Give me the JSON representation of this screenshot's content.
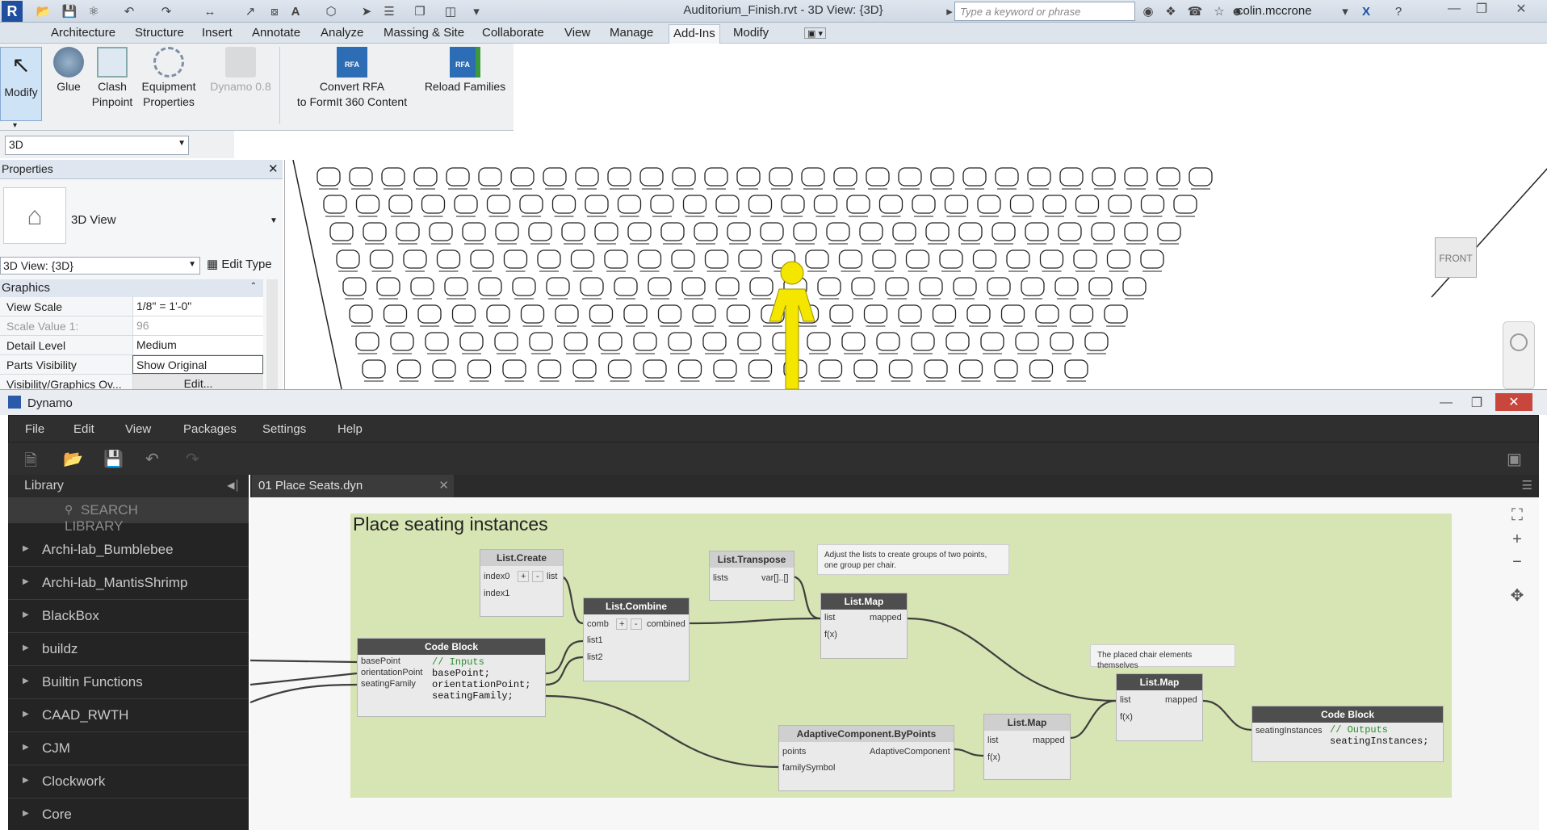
{
  "revit": {
    "title": "Auditorium_Finish.rvt - 3D View: {3D}",
    "search_placeholder": "Type a keyword or phrase",
    "user": "colin.mccrone",
    "tabs": [
      "Architecture",
      "Structure",
      "Insert",
      "Annotate",
      "Analyze",
      "Massing & Site",
      "Collaborate",
      "View",
      "Manage",
      "Add-Ins",
      "Modify"
    ],
    "active_tab": "Add-Ins",
    "ribbon_buttons": {
      "modify": "Modify",
      "glue": "Glue",
      "clash_1": "Clash",
      "clash_2": "Pinpoint",
      "equip_1": "Equipment",
      "equip_2": "Properties",
      "dynamo": "Dynamo 0.8",
      "convert_1": "Convert RFA",
      "convert_2": "to FormIt 360 Content",
      "reload": "Reload Families"
    },
    "type_selector": "3D",
    "properties": {
      "title": "Properties",
      "family": "3D View",
      "instance": "3D View: {3D}",
      "edit_type": "Edit Type",
      "section": "Graphics",
      "rows": [
        {
          "k": "View Scale",
          "v": "1/8\" = 1'-0\""
        },
        {
          "k": "Scale Value    1:",
          "v": "96"
        },
        {
          "k": "Detail Level",
          "v": "Medium"
        },
        {
          "k": "Parts Visibility",
          "v": "Show Original"
        },
        {
          "k": "Visibility/Graphics Ov...",
          "v": "Edit..."
        }
      ]
    },
    "viewcube_label": "FRONT"
  },
  "dynamo": {
    "title": "Dynamo",
    "menu": [
      "File",
      "Edit",
      "View",
      "Packages",
      "Settings",
      "Help"
    ],
    "library_title": "Library",
    "search_placeholder": "SEARCH LIBRARY",
    "library_items": [
      "Archi-lab_Bumblebee",
      "Archi-lab_MantisShrimp",
      "BlackBox",
      "buildz",
      "Builtin Functions",
      "CAAD_RWTH",
      "CJM",
      "Clockwork",
      "Core"
    ],
    "workspace_tab": "01 Place Seats.dyn",
    "group_title": "Place seating instances",
    "notes": {
      "transpose_note": "Adjust the lists to create groups of two points, one group per chair.",
      "chair_note": "The placed chair elements themselves"
    },
    "nodes": {
      "list_create": {
        "title": "List.Create",
        "in0": "index0",
        "in1": "index1",
        "out": "list"
      },
      "list_transpose": {
        "title": "List.Transpose",
        "in": "lists",
        "out": "var[]..[]"
      },
      "list_combine": {
        "title": "List.Combine",
        "in0": "comb",
        "in1": "list1",
        "in2": "list2",
        "out": "combined"
      },
      "list_map_1": {
        "title": "List.Map",
        "in0": "list",
        "in1": "f(x)",
        "out": "mapped"
      },
      "code_block_1": {
        "title": "Code Block",
        "in0": "basePoint",
        "in1": "orientationPoint",
        "in2": "seatingFamily",
        "line0": "// Inputs",
        "line1": "basePoint;",
        "line2": "orientationPoint;",
        "line3": "seatingFamily;"
      },
      "adaptive": {
        "title": "AdaptiveComponent.ByPoints",
        "in0": "points",
        "in1": "familySymbol",
        "out": "AdaptiveComponent"
      },
      "list_map_2": {
        "title": "List.Map",
        "in0": "list",
        "in1": "f(x)",
        "out": "mapped"
      },
      "list_map_3": {
        "title": "List.Map",
        "in0": "list",
        "in1": "f(x)",
        "out": "mapped"
      },
      "code_block_2": {
        "title": "Code Block",
        "in0": "seatingInstances",
        "line0": "// Outputs",
        "line1": "seatingInstances;"
      }
    }
  }
}
